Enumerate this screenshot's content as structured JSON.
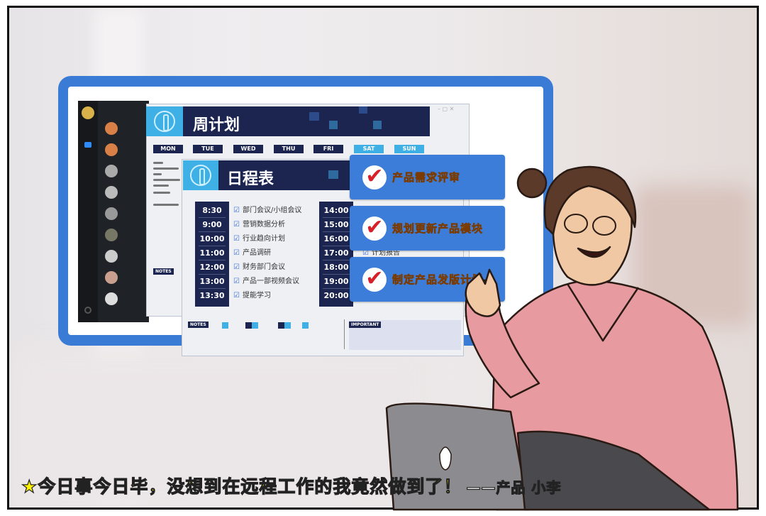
{
  "weekly_plan": {
    "title": "周计划",
    "days": [
      "MON",
      "TUE",
      "WED",
      "THU",
      "FRI",
      "SAT",
      "SUN"
    ],
    "notes_label": "NOTES"
  },
  "daily_schedule": {
    "title": "日程表",
    "morning": [
      {
        "time": "8:30",
        "task": "部门会议/小组会议"
      },
      {
        "time": "9:00",
        "task": "营销数据分析"
      },
      {
        "time": "10:00",
        "task": "行业趋向计划"
      },
      {
        "time": "11:00",
        "task": "产品调研"
      },
      {
        "time": "12:00",
        "task": "财务部门会议"
      },
      {
        "time": "13:00",
        "task": "产品一部视频会议"
      },
      {
        "time": "13:30",
        "task": "提能学习"
      }
    ],
    "afternoon_times": [
      "14:00",
      "15:00",
      "16:00",
      "17:00",
      "18:00",
      "19:00",
      "20:00"
    ],
    "afternoon_visible_task": "计划报告",
    "notes_label": "NOTES",
    "important_label": "IMPORTANT"
  },
  "banners": [
    {
      "icon": "checkmark-icon",
      "text": "产品需求评审"
    },
    {
      "icon": "checkmark-icon",
      "text": "规划更新产品模块"
    },
    {
      "icon": "checkmark-icon",
      "text": "制定产品发版计划"
    }
  ],
  "caption": {
    "icon": "star-icon",
    "text": "今日事今日毕，没想到在远程工作的我竟然做到了！",
    "signature": "——产品 小李"
  },
  "colors": {
    "monitor_blue": "#3a7bd6",
    "navy": "#1c2550",
    "accent_cyan": "#3eb0e6",
    "banner_text": "#f6a928",
    "caption_yellow": "#fff200",
    "sweater_pink": "#e79aa0"
  }
}
